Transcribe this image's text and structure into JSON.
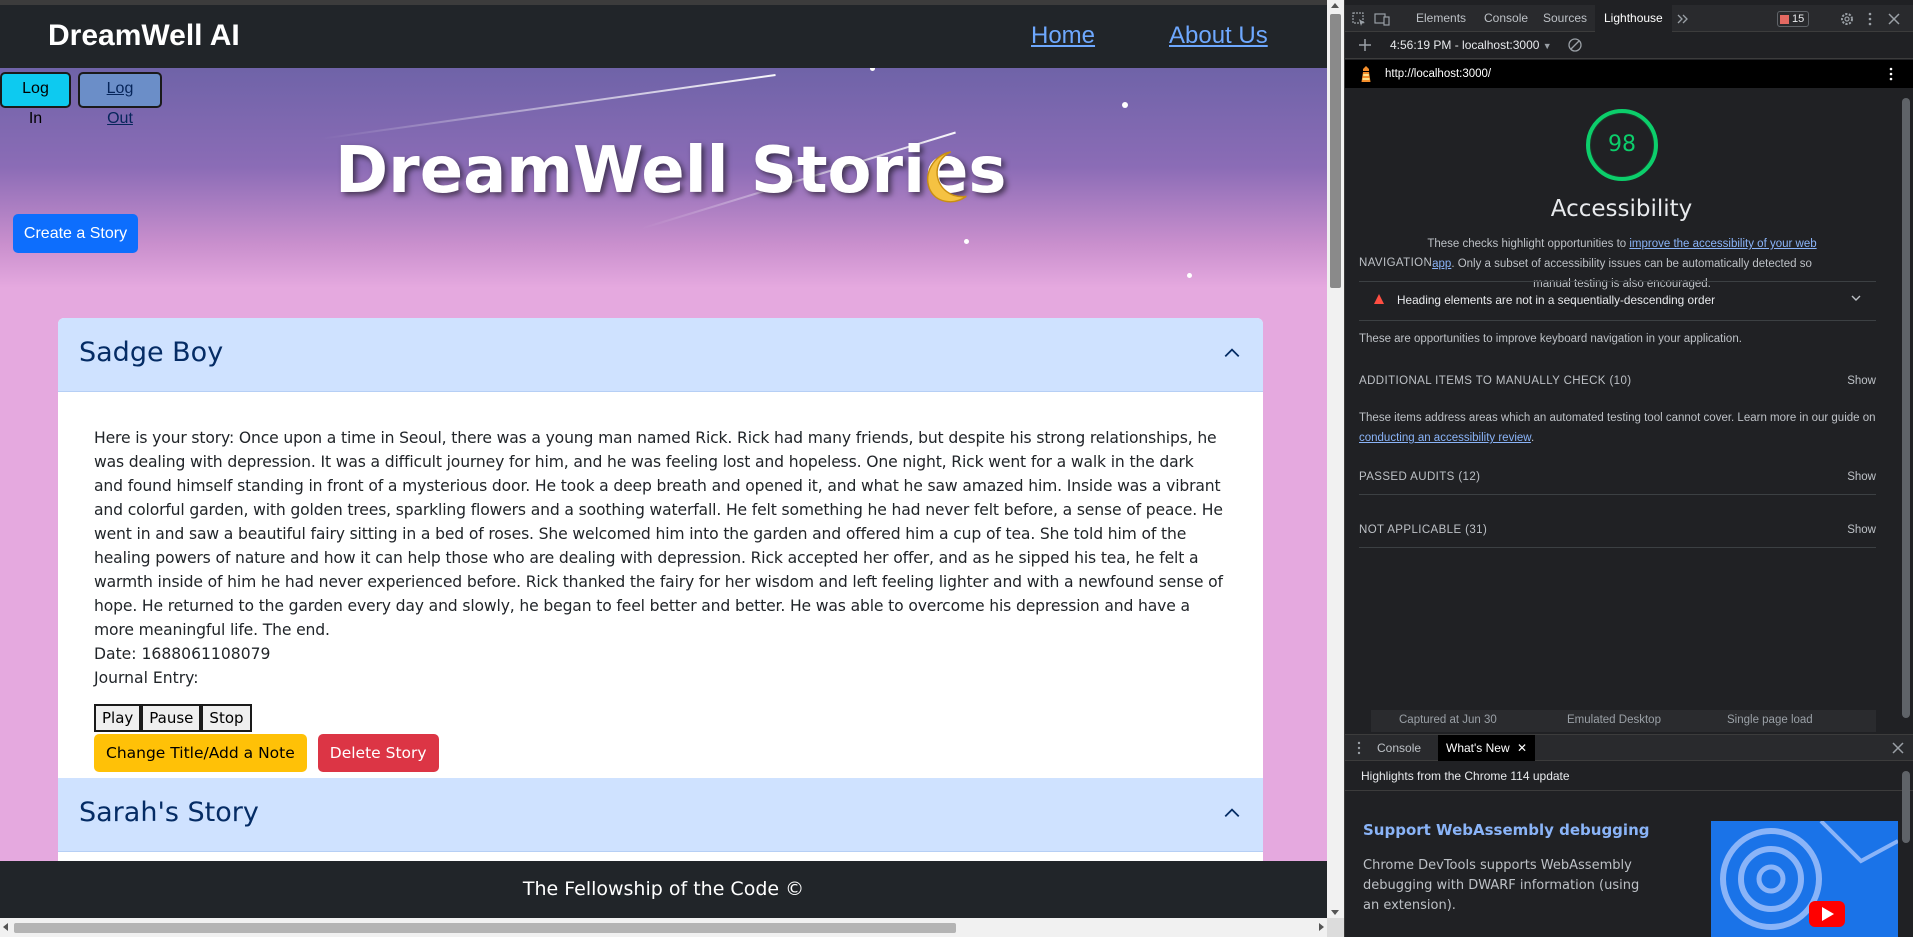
{
  "page": {
    "brand": "DreamWell AI",
    "nav": {
      "home": "Home",
      "about": "About Us"
    },
    "auth": {
      "login": "Log In",
      "logout": "Log Out"
    },
    "hero": {
      "title": "DreamWell Stories",
      "moon_icon": "crescent-moon-icon"
    },
    "create_button": "Create a Story",
    "stories": [
      {
        "title": "Sadge Boy",
        "expanded": true,
        "text": "Here is your story: Once upon a time in Seoul, there was a young man named Rick. Rick had many friends, but despite his strong relationships, he was dealing with depression. It was a difficult journey for him, and he was feeling lost and hopeless. One night, Rick went for a walk in the dark and found himself standing in front of a mysterious door. He took a deep breath and opened it, and what he saw amazed him. Inside was a vibrant and colorful garden, with golden trees, sparkling flowers and a soothing waterfall. He felt something he had never felt before, a sense of peace. He went in and saw a beautiful fairy sitting in a bed of roses. She welcomed him into the garden and offered him a cup of tea. She told him of the healing powers of nature and how it can help those who are dealing with depression. Rick accepted her offer, and as he sipped his tea, he felt a warmth inside of him he had never experienced before. Rick thanked the fairy for her wisdom and left feeling lighter and with a newfound sense of hope. He returned to the garden every day and slowly, he began to feel better and better. He was able to overcome his depression and have a more meaningful life. The end.",
        "date_line": "Date: 1688061108079",
        "journal_line": "Journal Entry:",
        "audio": {
          "play": "Play",
          "pause": "Pause",
          "stop": "Stop"
        },
        "edit_button": "Change Title/Add a Note",
        "delete_button": "Delete Story"
      },
      {
        "title": "Sarah's Story",
        "expanded": true
      }
    ],
    "footer": "The Fellowship of the Code ©"
  },
  "devtools": {
    "tabs": [
      "Elements",
      "Console",
      "Sources",
      "Lighthouse"
    ],
    "active_tab": "Lighthouse",
    "issues_count": "15",
    "report_selector": "4:56:19 PM - localhost:3000",
    "report_url": "http://localhost:3000/",
    "lighthouse": {
      "score": 98,
      "score_color": "#0cce6b",
      "category": "Accessibility",
      "description_pre": "These checks highlight opportunities to ",
      "description_link": "improve the accessibility of your web app",
      "description_post": ". Only a subset of accessibility issues can be automatically detected so manual testing is also encouraged.",
      "navigation_group": "NAVIGATION",
      "failed_audit": "Heading elements are not in a sequentially-descending order",
      "navigation_desc": "These are opportunities to improve keyboard navigation in your application.",
      "manual_group": "ADDITIONAL ITEMS TO MANUALLY CHECK (10)",
      "manual_desc_pre": "These items address areas which an automated testing tool cannot cover. Learn more in our guide on ",
      "manual_desc_link": "conducting an accessibility review",
      "manual_desc_post": ".",
      "passed_group": "PASSED AUDITS (12)",
      "na_group": "NOT APPLICABLE (31)",
      "show_label": "Show",
      "footer_items": [
        "Captured at Jun 30",
        "Emulated Desktop",
        "Single page load"
      ]
    },
    "drawer": {
      "tabs": [
        "Console",
        "What's New"
      ],
      "active_tab": "What's New",
      "highlights": "Highlights from the Chrome 114 update",
      "whatsnew_title": "Support WebAssembly debugging",
      "whatsnew_desc": "Chrome DevTools supports WebAssembly debugging with DWARF information (using an extension)."
    }
  }
}
